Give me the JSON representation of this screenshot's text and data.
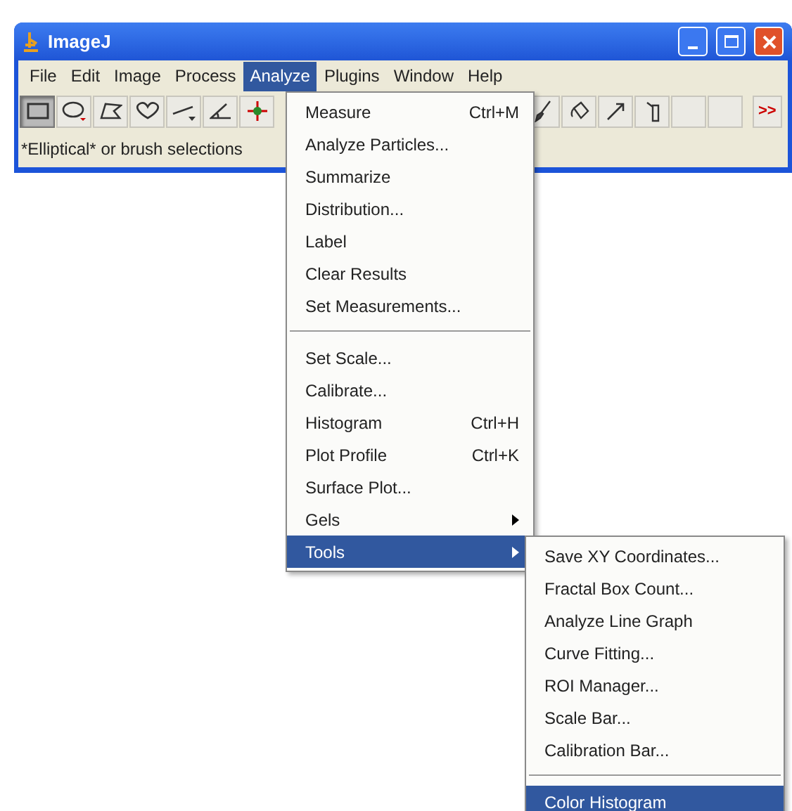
{
  "window": {
    "title": "ImageJ"
  },
  "menubar": [
    {
      "label": "File",
      "selected": false
    },
    {
      "label": "Edit",
      "selected": false
    },
    {
      "label": "Image",
      "selected": false
    },
    {
      "label": "Process",
      "selected": false
    },
    {
      "label": "Analyze",
      "selected": true
    },
    {
      "label": "Plugins",
      "selected": false
    },
    {
      "label": "Window",
      "selected": false
    },
    {
      "label": "Help",
      "selected": false
    }
  ],
  "toolbar": {
    "left_tools": [
      {
        "kind": "rectangle",
        "selected": true
      },
      {
        "kind": "oval",
        "selected": false
      },
      {
        "kind": "polygon",
        "selected": false
      },
      {
        "kind": "freehand",
        "selected": false
      },
      {
        "kind": "line",
        "selected": false
      },
      {
        "kind": "angle",
        "selected": false
      },
      {
        "kind": "point",
        "selected": false
      }
    ],
    "right_tools": [
      {
        "kind": "brush",
        "selected": false
      },
      {
        "kind": "bucket",
        "selected": false
      },
      {
        "kind": "arrow",
        "selected": false
      },
      {
        "kind": "dropper",
        "selected": false
      },
      {
        "kind": "empty",
        "selected": false
      },
      {
        "kind": "empty",
        "selected": false
      }
    ],
    "more": ">>"
  },
  "status": "*Elliptical* or brush selections",
  "analyze_menu": [
    {
      "kind": "item",
      "label": "Measure",
      "shortcut": "Ctrl+M",
      "selected": false
    },
    {
      "kind": "item",
      "label": "Analyze Particles...",
      "selected": false
    },
    {
      "kind": "item",
      "label": "Summarize",
      "selected": false
    },
    {
      "kind": "item",
      "label": "Distribution...",
      "selected": false
    },
    {
      "kind": "item",
      "label": "Label",
      "selected": false
    },
    {
      "kind": "item",
      "label": "Clear Results",
      "selected": false
    },
    {
      "kind": "item",
      "label": "Set Measurements...",
      "selected": false
    },
    {
      "kind": "separator"
    },
    {
      "kind": "item",
      "label": "Set Scale...",
      "selected": false
    },
    {
      "kind": "item",
      "label": "Calibrate...",
      "selected": false
    },
    {
      "kind": "item",
      "label": "Histogram",
      "shortcut": "Ctrl+H",
      "selected": false
    },
    {
      "kind": "item",
      "label": "Plot Profile",
      "shortcut": "Ctrl+K",
      "selected": false
    },
    {
      "kind": "item",
      "label": "Surface Plot...",
      "selected": false
    },
    {
      "kind": "submenu",
      "label": "Gels",
      "selected": false
    },
    {
      "kind": "submenu",
      "label": "Tools",
      "selected": true
    }
  ],
  "tools_submenu": [
    {
      "kind": "item",
      "label": "Save XY Coordinates...",
      "selected": false
    },
    {
      "kind": "item",
      "label": "Fractal Box Count...",
      "selected": false
    },
    {
      "kind": "item",
      "label": "Analyze Line Graph",
      "selected": false
    },
    {
      "kind": "item",
      "label": "Curve Fitting...",
      "selected": false
    },
    {
      "kind": "item",
      "label": "ROI Manager...",
      "selected": false
    },
    {
      "kind": "item",
      "label": "Scale Bar...",
      "selected": false
    },
    {
      "kind": "item",
      "label": "Calibration Bar...",
      "selected": false
    },
    {
      "kind": "separator"
    },
    {
      "kind": "item",
      "label": "Color Histogram",
      "selected": true
    }
  ]
}
